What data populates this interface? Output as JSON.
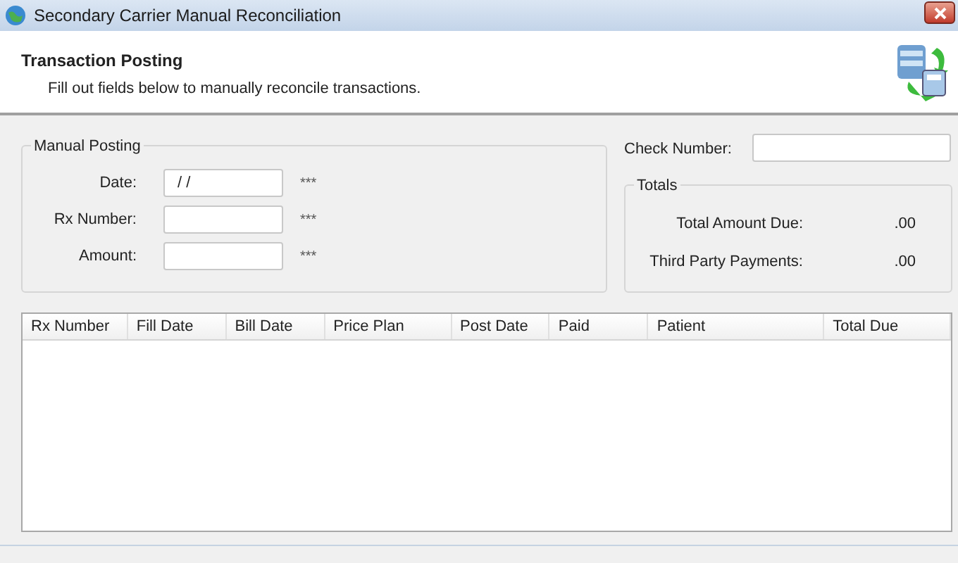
{
  "window": {
    "title": "Secondary Carrier Manual Reconciliation"
  },
  "header": {
    "title": "Transaction Posting",
    "subtitle": "Fill out fields below to manually reconcile transactions."
  },
  "manual_posting": {
    "title": "Manual Posting",
    "fields": [
      {
        "label": "Date:",
        "value": " / /",
        "required": "***"
      },
      {
        "label": "Rx Number:",
        "required": "***"
      },
      {
        "label": "Amount:",
        "required": "***"
      }
    ]
  },
  "check_number": {
    "label": "Check Number:"
  },
  "totals": {
    "title": "Totals",
    "rows": [
      {
        "label": "Total Amount Due:",
        "value": ".00"
      },
      {
        "label": "Third Party Payments:",
        "value": ".00"
      }
    ]
  },
  "table": {
    "columns": [
      "Rx Number",
      "Fill Date",
      "Bill Date",
      "Price Plan",
      "Post Date",
      "Paid",
      "Patient",
      "Total Due"
    ]
  }
}
